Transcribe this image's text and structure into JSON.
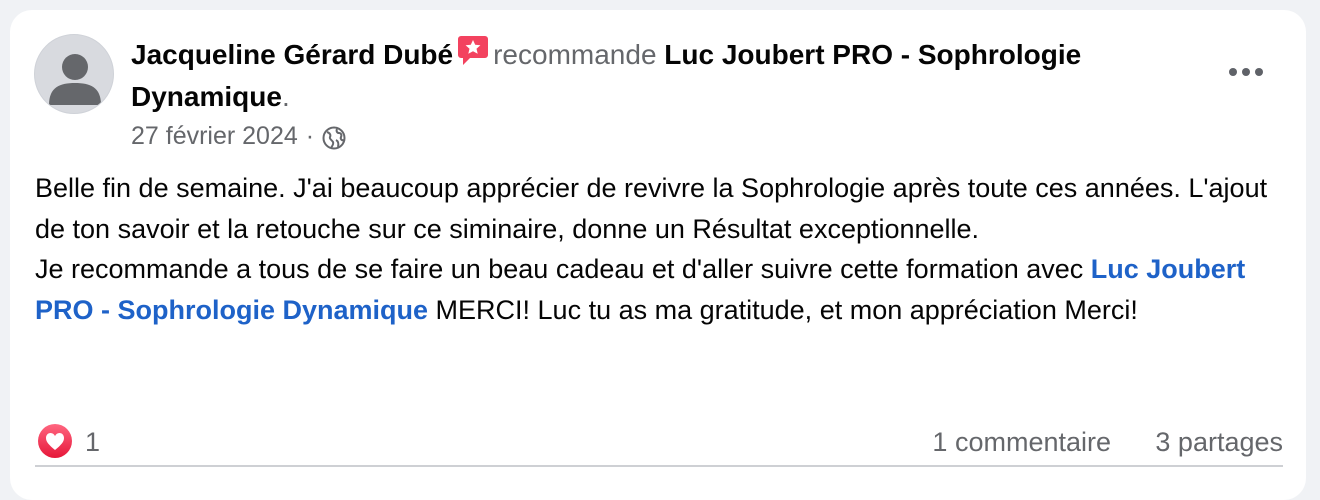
{
  "post": {
    "author": "Jacqueline Gérard Dubé",
    "verb": "recommande",
    "page_name": "Luc Joubert PRO - Sophrologie Dynamique",
    "period": ".",
    "date": "27 février 2024",
    "separator": "·",
    "audience_icon": "globe-icon",
    "more_icon": "more-options-icon",
    "recommend_icon": "recommendation-star-icon",
    "body": {
      "paragraph1": "Belle fin de semaine. J'ai beaucoup apprécier de revivre la Sophrologie après toute ces années. L'ajout de ton savoir et la retouche sur ce siminaire, donne un Résultat exceptionnelle.",
      "paragraph2_start": "Je recommande a tous de se faire un beau cadeau et d'aller suivre cette formation avec ",
      "mention": "Luc Joubert PRO - Sophrologie Dynamique",
      "paragraph2_end": " MERCI! Luc tu as ma gratitude, et mon appréciation Merci!"
    },
    "reactions": {
      "icon": "love-reaction-icon",
      "count": "1"
    },
    "comments_label": "1 commentaire",
    "shares_label": "3 partages"
  },
  "colors": {
    "background": "#f0f2f5",
    "card": "#ffffff",
    "text": "#050505",
    "secondary_text": "#65676b",
    "link": "#1e62c8",
    "recommend_badge": "#f3425f"
  }
}
